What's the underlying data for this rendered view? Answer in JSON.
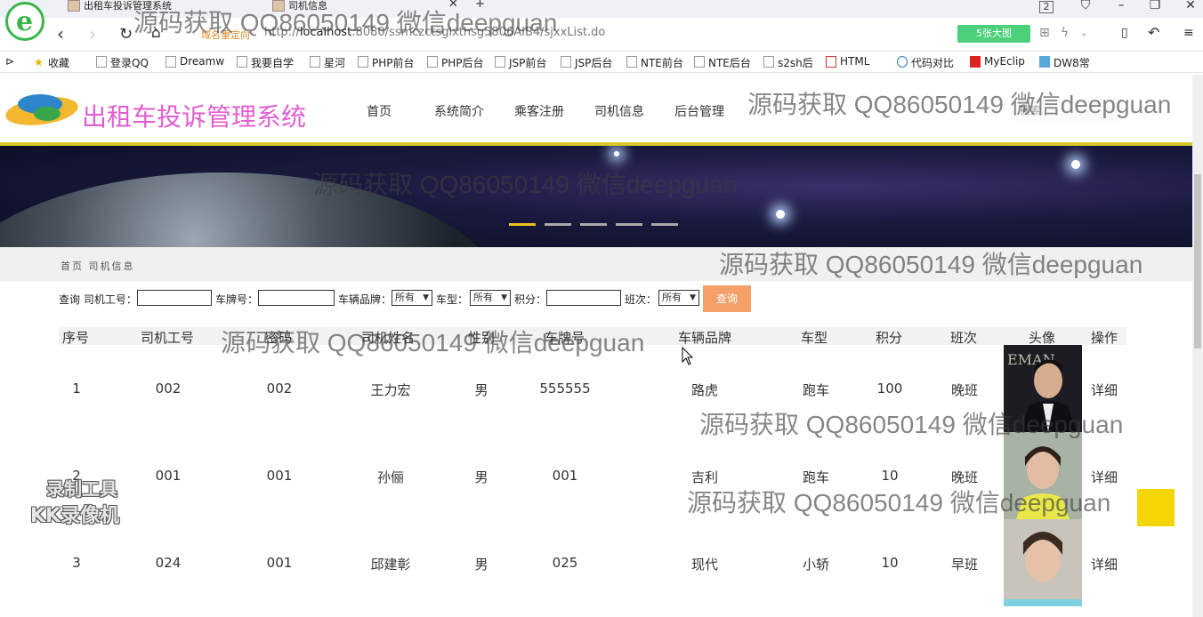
{
  "browser": {
    "tabs": [
      {
        "title": "出租车投诉管理系统"
      },
      {
        "title": "司机信息"
      }
    ],
    "address": {
      "redirect_tag": "域名重定向",
      "url_host": "localhost",
      "url_rest": ":8080/ssmczctsglxthsg5806AIB4/sjxxList.do"
    },
    "bigimg_label": "5张大图",
    "bookmarks": [
      "收藏",
      "登录QQ",
      "Dreamw",
      "我要自学",
      "星河",
      "PHP前台",
      "PHP后台",
      "JSP前台",
      "JSP后台",
      "NTE前台",
      "NTE后台",
      "s2sh后",
      "HTML",
      "代码对比",
      "MyEclip",
      "DW8常"
    ]
  },
  "site": {
    "title": "出租车投诉管理系统",
    "nav": [
      "首页",
      "系统简介",
      "乘客注册",
      "司机信息",
      "后台管理"
    ],
    "search_placeholder": "搜索"
  },
  "breadcrumb": "首页 司机信息",
  "filter": {
    "query_label": "查询",
    "labels": [
      "司机工号：",
      "车牌号：",
      "车辆品牌：",
      "车型：",
      "积分：",
      "班次："
    ],
    "select_value": "所有",
    "button": "查询"
  },
  "table": {
    "headers": [
      "序号",
      "司机工号",
      "密码",
      "司机姓名",
      "性别",
      "车牌号",
      "车辆品牌",
      "车型",
      "积分",
      "班次",
      "头像",
      "操作"
    ],
    "rows": [
      {
        "index": "1",
        "id": "002",
        "pwd": "002",
        "name": "王力宏",
        "gender": "男",
        "plate": "555555",
        "brand": "路虎",
        "type": "跑车",
        "score": "100",
        "shift": "晚班",
        "action": "详细"
      },
      {
        "index": "2",
        "id": "001",
        "pwd": "001",
        "name": "孙俪",
        "gender": "男",
        "plate": "001",
        "brand": "吉利",
        "type": "跑车",
        "score": "10",
        "shift": "晚班",
        "action": "详细"
      },
      {
        "index": "3",
        "id": "024",
        "pwd": "001",
        "name": "邱建彰",
        "gender": "男",
        "plate": "025",
        "brand": "现代",
        "type": "小轿",
        "score": "10",
        "shift": "早班",
        "action": "详细"
      }
    ]
  },
  "watermark": "源码获取 QQ86050149 微信deepguan",
  "rec_badge": {
    "line1": "录制工具",
    "line2": "KK录像机"
  },
  "colors": {
    "title_pink": "#e25dd0",
    "accent_yellow": "#d8cd2a",
    "query_btn": "#f4a068",
    "bigimg_green": "#4cd07a"
  }
}
